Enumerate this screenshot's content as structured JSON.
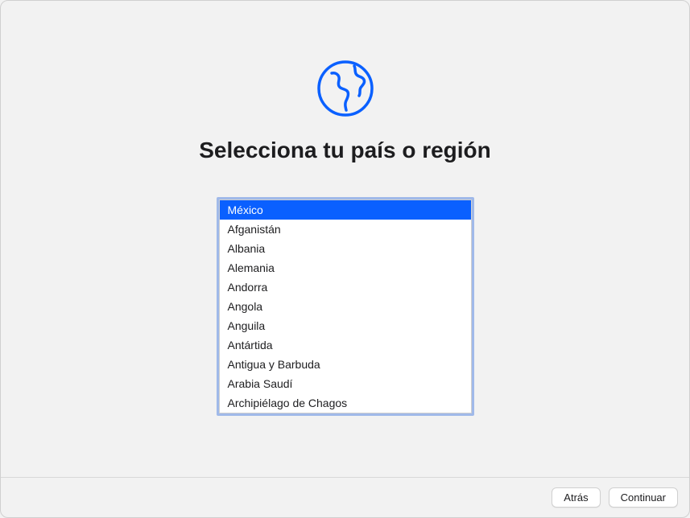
{
  "header": {
    "icon": "globe-icon",
    "title": "Selecciona tu país o región"
  },
  "countries": {
    "selected_index": 0,
    "items": [
      "México",
      "Afganistán",
      "Albania",
      "Alemania",
      "Andorra",
      "Angola",
      "Anguila",
      "Antártida",
      "Antigua y Barbuda",
      "Arabia Saudí",
      "Archipiélago de Chagos"
    ]
  },
  "footer": {
    "back_label": "Atrás",
    "continue_label": "Continuar"
  },
  "colors": {
    "accent": "#0a60ff",
    "focus_ring": "#a0b9e9"
  }
}
